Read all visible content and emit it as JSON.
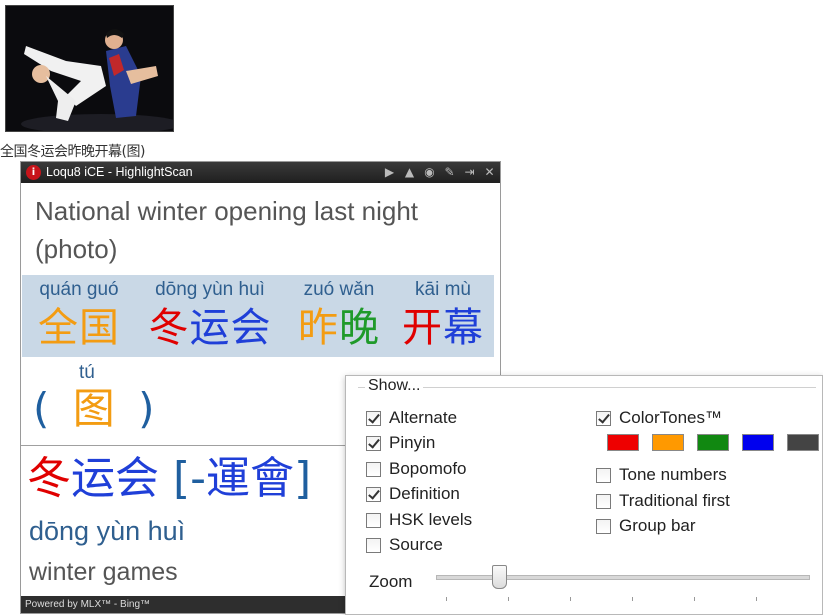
{
  "photo": {
    "caption": "全国冬运会昨晚开幕(图)"
  },
  "popup": {
    "logo": "i",
    "title": "Loqu8 iCE - HighlightScan",
    "toolbar_icons": [
      "play-icon",
      "pin-icon",
      "camera-icon",
      "wrench-icon",
      "dock-icon",
      "close-icon"
    ],
    "toolbar_glyphs": [
      "▶",
      "▲",
      "◉",
      "✎",
      "⇥",
      "✕"
    ],
    "english": "National winter opening last night (photo)",
    "words": [
      {
        "pinyin": "quán guó",
        "chars": [
          {
            "c": "全",
            "color": "#f39c12"
          },
          {
            "c": "国",
            "color": "#f39c12"
          }
        ]
      },
      {
        "pinyin": "dōng yùn huì",
        "chars": [
          {
            "c": "冬",
            "color": "#e00000"
          },
          {
            "c": "运",
            "color": "#1f3fd8"
          },
          {
            "c": "会",
            "color": "#1f3fd8"
          }
        ]
      },
      {
        "pinyin": "zuó wǎn",
        "chars": [
          {
            "c": "昨",
            "color": "#f39c12"
          },
          {
            "c": "晚",
            "color": "#1f9a2a"
          }
        ]
      },
      {
        "pinyin": "kāi mù",
        "chars": [
          {
            "c": "开",
            "color": "#e00000"
          },
          {
            "c": "幕",
            "color": "#1f3fd8"
          }
        ]
      }
    ],
    "paren": {
      "pinyin": "tú",
      "open": "(",
      "char": "图",
      "close": ")"
    },
    "entry": {
      "chars": [
        {
          "c": "冬",
          "color": "#e00000"
        },
        {
          "c": "运",
          "color": "#1f3fd8"
        },
        {
          "c": "会",
          "color": "#1f3fd8"
        }
      ],
      "alt_open": " [-",
      "alt_chars": [
        {
          "c": "運",
          "color": "#1f3fd8"
        },
        {
          "c": "會",
          "color": "#1f3fd8"
        }
      ],
      "alt_close": "]",
      "pinyin": "dōng yùn huì",
      "definition": "winter games"
    },
    "status": "Powered by MLX™ - Bing™"
  },
  "options": {
    "legend": "Show...",
    "left": [
      {
        "label": "Alternate",
        "checked": true
      },
      {
        "label": "Pinyin",
        "checked": true
      },
      {
        "label": "Bopomofo",
        "checked": false
      },
      {
        "label": "Definition",
        "checked": true
      },
      {
        "label": "HSK levels",
        "checked": false
      },
      {
        "label": "Source",
        "checked": false
      }
    ],
    "right": [
      {
        "label": "ColorTones™",
        "checked": true
      },
      {
        "label": "Tone numbers",
        "checked": false
      },
      {
        "label": "Traditional first",
        "checked": false
      },
      {
        "label": "Group bar",
        "checked": false
      }
    ],
    "tone_colors": [
      "#ee0000",
      "#ff9900",
      "#118811",
      "#0000ee",
      "#444444"
    ],
    "zoom_label": "Zoom",
    "zoom_level": 0.17
  },
  "colors": {
    "bracket": "#1f5f9f",
    "word_band": "#c9d8e6"
  }
}
